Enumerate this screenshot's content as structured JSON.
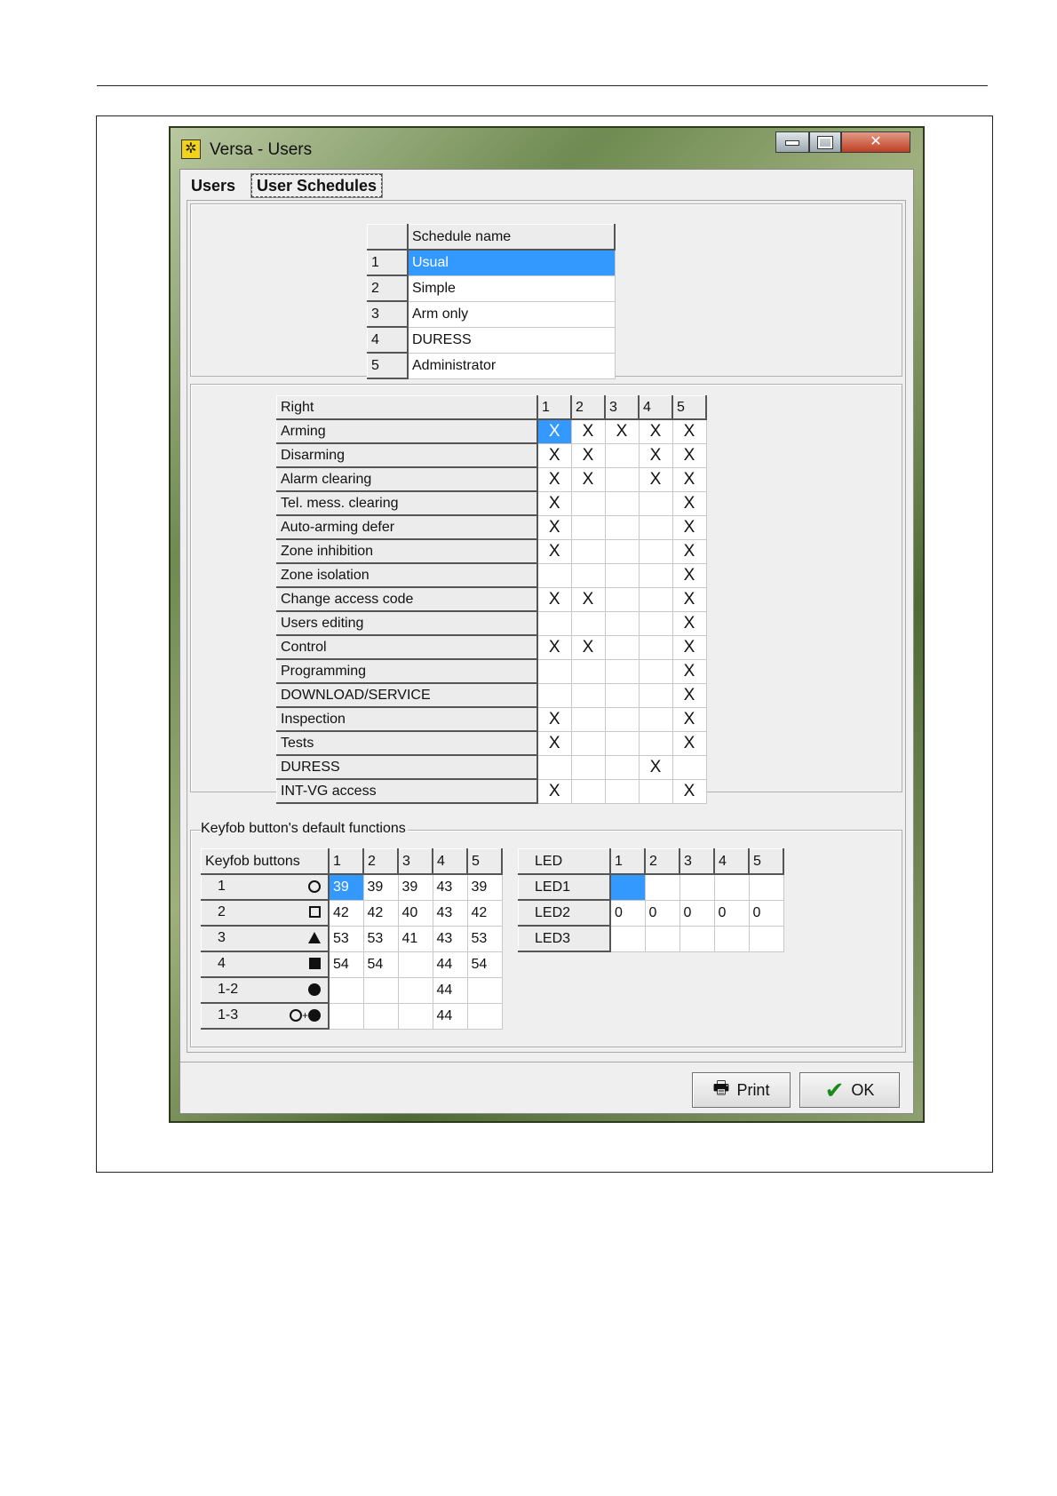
{
  "window": {
    "title": "Versa - Users"
  },
  "tabs": [
    {
      "label": "Users"
    },
    {
      "label": "User Schedules"
    }
  ],
  "schedules": {
    "header": "Schedule name",
    "rows": [
      {
        "num": "1",
        "name": "Usual"
      },
      {
        "num": "2",
        "name": "Simple"
      },
      {
        "num": "3",
        "name": "Arm only"
      },
      {
        "num": "4",
        "name": "DURESS"
      },
      {
        "num": "5",
        "name": "Administrator"
      }
    ]
  },
  "rights": {
    "header": "Right",
    "columns": [
      "1",
      "2",
      "3",
      "4",
      "5"
    ],
    "rows": [
      {
        "label": "Arming",
        "marks": [
          "X",
          "X",
          "X",
          "X",
          "X"
        ]
      },
      {
        "label": "Disarming",
        "marks": [
          "X",
          "X",
          "",
          "X",
          "X"
        ]
      },
      {
        "label": "Alarm clearing",
        "marks": [
          "X",
          "X",
          "",
          "X",
          "X"
        ]
      },
      {
        "label": "Tel. mess. clearing",
        "marks": [
          "X",
          "",
          "",
          "",
          "X"
        ]
      },
      {
        "label": "Auto-arming defer",
        "marks": [
          "X",
          "",
          "",
          "",
          "X"
        ]
      },
      {
        "label": "Zone inhibition",
        "marks": [
          "X",
          "",
          "",
          "",
          "X"
        ]
      },
      {
        "label": "Zone isolation",
        "marks": [
          "",
          "",
          "",
          "",
          "X"
        ]
      },
      {
        "label": "Change access code",
        "marks": [
          "X",
          "X",
          "",
          "",
          "X"
        ]
      },
      {
        "label": "Users editing",
        "marks": [
          "",
          "",
          "",
          "",
          "X"
        ]
      },
      {
        "label": "Control",
        "marks": [
          "X",
          "X",
          "",
          "",
          "X"
        ]
      },
      {
        "label": "Programming",
        "marks": [
          "",
          "",
          "",
          "",
          "X"
        ]
      },
      {
        "label": "DOWNLOAD/SERVICE",
        "marks": [
          "",
          "",
          "",
          "",
          "X"
        ]
      },
      {
        "label": "Inspection",
        "marks": [
          "X",
          "",
          "",
          "",
          "X"
        ]
      },
      {
        "label": "Tests",
        "marks": [
          "X",
          "",
          "",
          "",
          "X"
        ]
      },
      {
        "label": "DURESS",
        "marks": [
          "",
          "",
          "",
          "X",
          ""
        ]
      },
      {
        "label": "INT-VG access",
        "marks": [
          "X",
          "",
          "",
          "",
          "X"
        ]
      }
    ]
  },
  "keyfob": {
    "legend": "Keyfob button's default functions",
    "buttons_header": "Keyfob buttons",
    "columns": [
      "1",
      "2",
      "3",
      "4",
      "5"
    ],
    "rows": [
      {
        "label": "1",
        "icon": "ring-icon",
        "values": [
          "39",
          "39",
          "39",
          "43",
          "39"
        ]
      },
      {
        "label": "2",
        "icon": "square-outline-icon",
        "values": [
          "42",
          "42",
          "40",
          "43",
          "42"
        ]
      },
      {
        "label": "3",
        "icon": "triangle-icon",
        "values": [
          "53",
          "53",
          "41",
          "43",
          "53"
        ]
      },
      {
        "label": "4",
        "icon": "filled-square-icon",
        "values": [
          "54",
          "54",
          "",
          "44",
          "54"
        ]
      },
      {
        "label": "1-2",
        "icon": "filled-circle-icon",
        "values": [
          "",
          "",
          "",
          "44",
          ""
        ]
      },
      {
        "label": "1-3",
        "icon": "ring-plus-dot-icon",
        "values": [
          "",
          "",
          "",
          "44",
          ""
        ]
      }
    ],
    "led_header": "LED",
    "leds": [
      {
        "label": "LED1",
        "values": [
          "",
          "",
          "",
          "",
          ""
        ]
      },
      {
        "label": "LED2",
        "values": [
          "0",
          "0",
          "0",
          "0",
          "0"
        ]
      },
      {
        "label": "LED3",
        "values": [
          "",
          "",
          "",
          "",
          ""
        ]
      }
    ]
  },
  "footer": {
    "print_label": "Print",
    "ok_label": "OK"
  },
  "colors": {
    "selection": "#3399ff",
    "ok_check": "#1a8a1a",
    "dialog_bg": "#efefef"
  }
}
